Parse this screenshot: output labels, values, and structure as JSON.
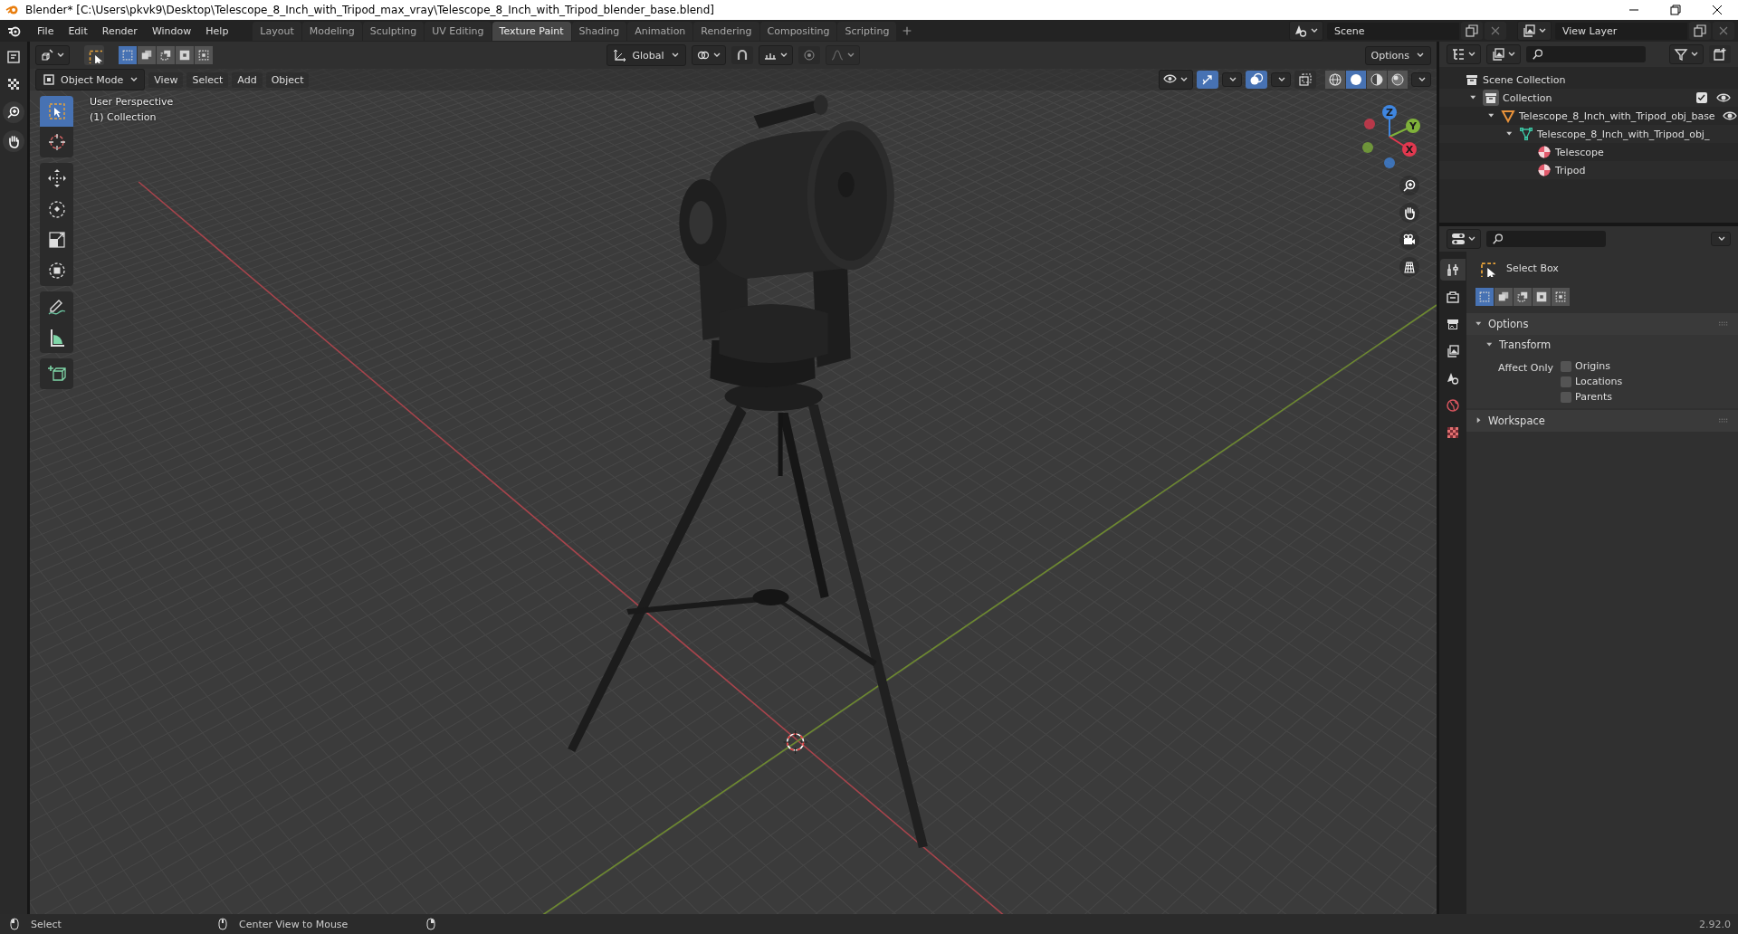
{
  "window": {
    "title": "Blender* [C:\\Users\\pkvk9\\Desktop\\Telescope_8_Inch_with_Tripod_max_vray\\Telescope_8_Inch_with_Tripod_blender_base.blend]"
  },
  "menu_bar": {
    "menus": [
      "File",
      "Edit",
      "Render",
      "Window",
      "Help"
    ],
    "workspace_tabs": [
      {
        "label": "Layout",
        "selected": false
      },
      {
        "label": "Modeling",
        "selected": false
      },
      {
        "label": "Sculpting",
        "selected": false
      },
      {
        "label": "UV Editing",
        "selected": false
      },
      {
        "label": "Texture Paint",
        "selected": true
      },
      {
        "label": "Shading",
        "selected": false
      },
      {
        "label": "Animation",
        "selected": false
      },
      {
        "label": "Rendering",
        "selected": false
      },
      {
        "label": "Compositing",
        "selected": false
      },
      {
        "label": "Scripting",
        "selected": false
      }
    ],
    "scene": "Scene",
    "view_layer": "View Layer"
  },
  "tool_header": {
    "select_modes": [
      {
        "kind": "set",
        "selected": true
      },
      {
        "kind": "extend",
        "selected": false
      },
      {
        "kind": "subtract",
        "selected": false
      },
      {
        "kind": "invert",
        "selected": false
      },
      {
        "kind": "intersect",
        "selected": false
      }
    ],
    "orientation": "Global",
    "options": "Options"
  },
  "viewport_header": {
    "mode": "Object Mode",
    "menus": [
      "View",
      "Select",
      "Add",
      "Object"
    ],
    "gizmos_on": true,
    "overlays_on": true,
    "xray": false,
    "shading_modes": [
      {
        "kind": "wireframe",
        "selected": false
      },
      {
        "kind": "solid",
        "selected": true
      },
      {
        "kind": "material",
        "selected": false
      },
      {
        "kind": "rendered",
        "selected": false
      }
    ]
  },
  "viewport": {
    "info": [
      "User Perspective",
      "(1) Collection"
    ],
    "tool_groups": [
      {
        "tools": [
          {
            "kind": "select_box",
            "selected": true
          },
          {
            "kind": "cursor",
            "selected": false
          }
        ]
      },
      {
        "tools": [
          {
            "kind": "move",
            "selected": false
          },
          {
            "kind": "rotate",
            "selected": false
          },
          {
            "kind": "scale",
            "selected": false
          },
          {
            "kind": "transform",
            "selected": false
          }
        ]
      },
      {
        "tools": [
          {
            "kind": "annotate",
            "selected": false
          },
          {
            "kind": "measure",
            "selected": false
          }
        ]
      },
      {
        "tools": [
          {
            "kind": "add_cube",
            "selected": false
          }
        ]
      }
    ],
    "gizmo_axes": [
      {
        "label": "Z",
        "color": "#3f86e0"
      },
      {
        "label": "Y",
        "color": "#7fb13a"
      },
      {
        "label": "X",
        "color": "#e2384f"
      }
    ]
  },
  "outliner": {
    "items": [
      {
        "label": "Scene Collection",
        "kind": "scene_collection",
        "children": [
          {
            "label": "Collection",
            "kind": "collection",
            "expanded": true,
            "checked": true,
            "visible": true,
            "children": [
              {
                "label": "Telescope_8_Inch_with_Tripod_obj_base",
                "kind": "empty",
                "expanded": true,
                "visible": true,
                "children": [
                  {
                    "label": "Telescope_8_Inch_with_Tripod_obj_",
                    "kind": "mesh",
                    "expanded": true,
                    "children": [
                      {
                        "label": "Telescope",
                        "kind": "material"
                      },
                      {
                        "label": "Tripod",
                        "kind": "material"
                      }
                    ]
                  }
                ]
              }
            ]
          }
        ]
      }
    ]
  },
  "properties": {
    "tabs": [
      {
        "kind": "tool",
        "selected": true
      },
      {
        "kind": "render",
        "selected": false
      },
      {
        "kind": "output",
        "selected": false
      },
      {
        "kind": "view_layer",
        "selected": false
      },
      {
        "kind": "scene",
        "selected": false
      },
      {
        "kind": "world",
        "selected": false
      },
      {
        "kind": "texture",
        "selected": false
      }
    ],
    "tool_name": "Select Box",
    "select_modes": [
      {
        "kind": "set",
        "selected": true
      },
      {
        "kind": "extend",
        "selected": false
      },
      {
        "kind": "subtract",
        "selected": false
      },
      {
        "kind": "invert",
        "selected": false
      },
      {
        "kind": "intersect",
        "selected": false
      }
    ],
    "panels": [
      {
        "title": "Options",
        "expanded": true,
        "subpanels": [
          {
            "title": "Transform",
            "expanded": true,
            "label": "Affect Only",
            "options": [
              {
                "label": "Origins",
                "checked": false
              },
              {
                "label": "Locations",
                "checked": false
              },
              {
                "label": "Parents",
                "checked": false
              }
            ]
          }
        ]
      },
      {
        "title": "Workspace",
        "expanded": false
      }
    ]
  },
  "status_bar": {
    "hints": [
      {
        "kind": "left_click",
        "label": "Select"
      },
      {
        "kind": "middle_click",
        "label": "Center View to Mouse"
      },
      {
        "kind": "right_click"
      }
    ],
    "version": "2.92.0"
  }
}
